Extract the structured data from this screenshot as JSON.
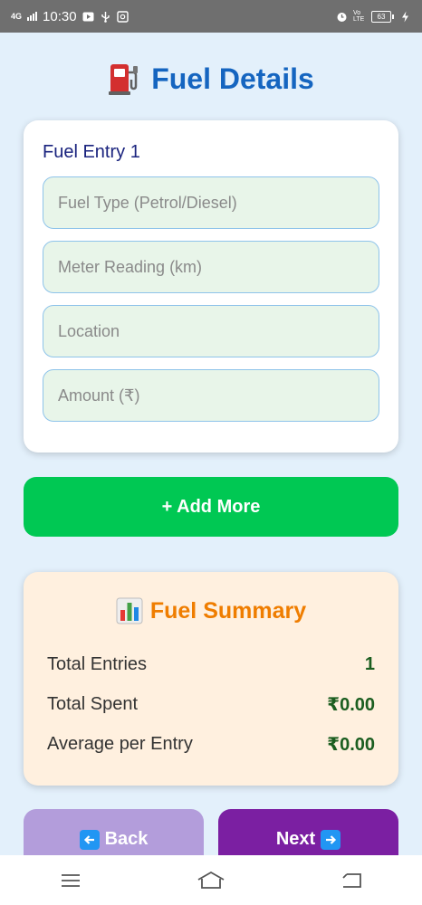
{
  "status_bar": {
    "network": "4G",
    "time": "10:30",
    "volte": "Vo LTE",
    "battery": "63",
    "icons": [
      "signal-icon",
      "play-icon",
      "usb-icon",
      "gallery-icon",
      "alarm-icon",
      "charging-icon"
    ]
  },
  "header": {
    "icon": "fuel-pump-icon",
    "title": "Fuel Details"
  },
  "entry": {
    "title": "Fuel Entry 1",
    "fields": [
      {
        "placeholder": "Fuel Type (Petrol/Diesel)",
        "value": ""
      },
      {
        "placeholder": "Meter Reading (km)",
        "value": ""
      },
      {
        "placeholder": "Location",
        "value": ""
      },
      {
        "placeholder": "Amount (₹)",
        "value": ""
      }
    ]
  },
  "add_button": "+ Add More",
  "summary": {
    "icon": "bar-chart-icon",
    "title": "Fuel Summary",
    "rows": [
      {
        "label": "Total Entries",
        "value": "1"
      },
      {
        "label": "Total Spent",
        "value": "₹0.00"
      },
      {
        "label": "Average per Entry",
        "value": "₹0.00"
      }
    ]
  },
  "navigation": {
    "back_label": "Back",
    "next_label": "Next"
  },
  "colors": {
    "title": "#1565c0",
    "add_button": "#00c853",
    "summary_title": "#ef7d00",
    "back_button": "#b39ddb",
    "next_button": "#7b1fa2",
    "background": "#e3f0fb"
  }
}
